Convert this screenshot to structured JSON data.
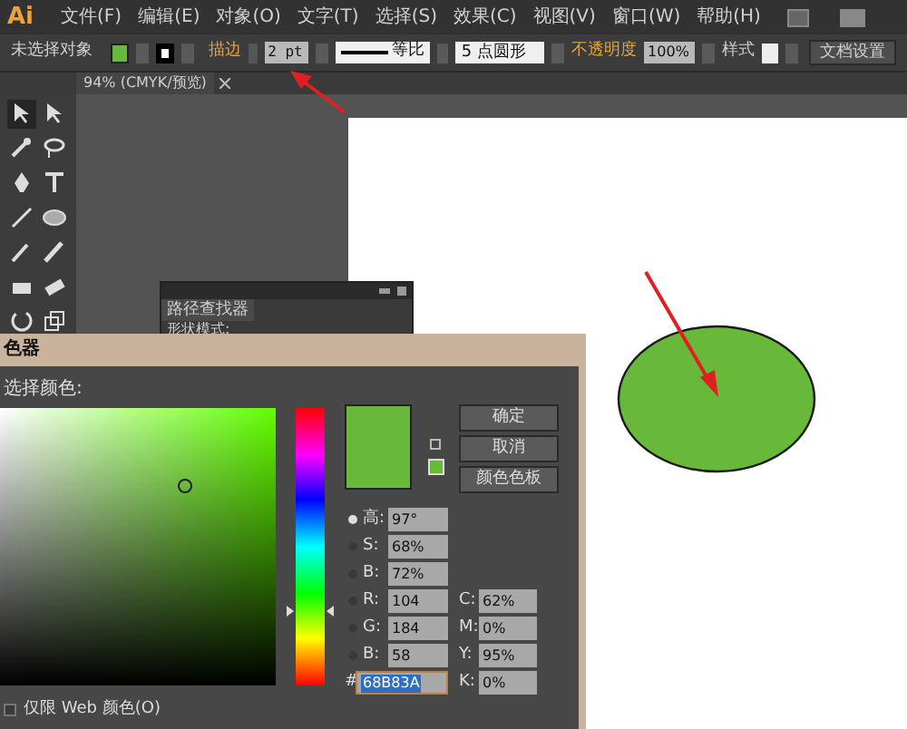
{
  "app": {
    "logo": "Ai"
  },
  "menu": [
    "文件(F)",
    "编辑(E)",
    "对象(O)",
    "文字(T)",
    "选择(S)",
    "效果(C)",
    "视图(V)",
    "窗口(W)",
    "帮助(H)"
  ],
  "control_bar": {
    "selection": "未选择对象",
    "stroke_label": "描边",
    "stroke_weight": "2 pt",
    "profile": "等比",
    "brush": "5 点圆形",
    "opacity_label": "不透明度",
    "opacity": "100%",
    "style_label": "样式",
    "document_setup": "文档设置"
  },
  "document_tab": {
    "title": "94% (CMYK/预览)"
  },
  "pathfinder_panel": {
    "title": "路径查找器",
    "subtitle": "形状模式:"
  },
  "color_picker": {
    "title": "色器",
    "prompt": "选择颜色:",
    "hue": {
      "level": 0.27
    },
    "buttons": [
      "确定",
      "取消",
      "颜色色板"
    ],
    "hsb_rgb": [
      {
        "label": "高:",
        "value": "97°",
        "selected": true
      },
      {
        "label": "S:",
        "value": "68%",
        "selected": false
      },
      {
        "label": "B:",
        "value": "72%",
        "selected": false
      },
      {
        "label": "R:",
        "value": "104",
        "selected": false
      },
      {
        "label": "G:",
        "value": "184",
        "selected": false
      },
      {
        "label": "B:",
        "value": "58",
        "selected": false
      }
    ],
    "cmyk": [
      {
        "label": "C:",
        "value": "62%"
      },
      {
        "label": "M:",
        "value": "0%"
      },
      {
        "label": "Y:",
        "value": "95%"
      },
      {
        "label": "K:",
        "value": "0%"
      }
    ],
    "hex": {
      "label": "#",
      "value": "68B83A"
    },
    "web_only": {
      "label": "仅限 Web 颜色(O)",
      "checked": false
    }
  }
}
